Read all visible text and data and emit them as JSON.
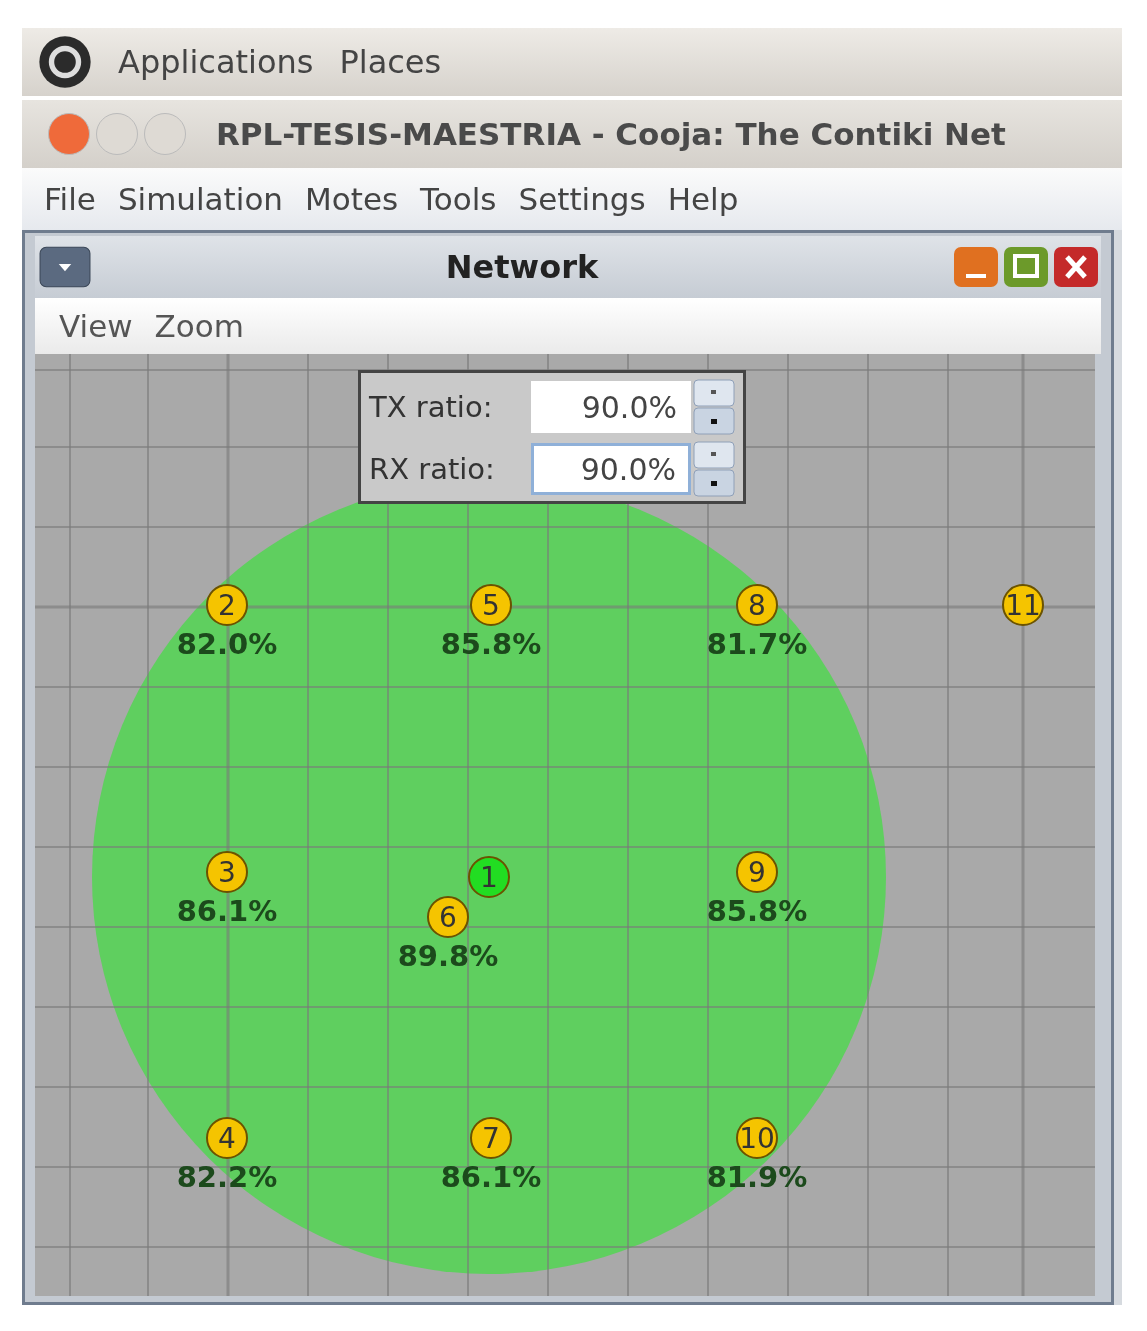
{
  "top_panel": {
    "items": [
      "Applications",
      "Places"
    ]
  },
  "window": {
    "title": "RPL-TESIS-MAESTRIA - Cooja: The Contiki Net"
  },
  "menu": [
    "File",
    "Simulation",
    "Motes",
    "Tools",
    "Settings",
    "Help"
  ],
  "network": {
    "title": "Network",
    "menu": [
      "View",
      "Zoom"
    ],
    "ratio_fields": [
      {
        "label": "TX ratio:",
        "value": "90.0%",
        "focused": false
      },
      {
        "label": "RX ratio:",
        "value": "90.0%",
        "focused": true
      }
    ],
    "motes": [
      {
        "id": "1",
        "color": "#22dd22"
      },
      {
        "id": "2",
        "color": "#f5c400",
        "reading": "82.0%"
      },
      {
        "id": "3",
        "color": "#f5c400",
        "reading": "86.1%"
      },
      {
        "id": "4",
        "color": "#f5c400",
        "reading": "82.2%"
      },
      {
        "id": "5",
        "color": "#f5c400",
        "reading": "85.8%"
      },
      {
        "id": "6",
        "color": "#f5c400",
        "reading": "89.8%"
      },
      {
        "id": "7",
        "color": "#f5c400",
        "reading": "86.1%"
      },
      {
        "id": "8",
        "color": "#f5c400",
        "reading": "81.7%"
      },
      {
        "id": "9",
        "color": "#f5c400",
        "reading": "85.8%"
      },
      {
        "id": "10",
        "color": "#f5c400",
        "reading": "81.9%"
      },
      {
        "id": "11",
        "color": "#f5c400"
      }
    ]
  }
}
